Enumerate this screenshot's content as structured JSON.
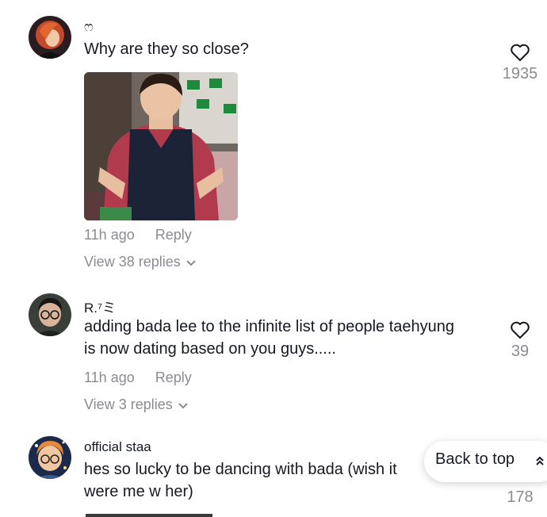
{
  "comments": [
    {
      "username": "ෆ",
      "text": "Why are they so close?",
      "time": "11h ago",
      "reply_label": "Reply",
      "view_replies": "View 38 replies",
      "likes": "1935",
      "has_gif": true
    },
    {
      "username": "R.⁷ミ",
      "text": "adding bada lee to the infinite list of people taehyung is now dating based on you guys.....",
      "time": "11h ago",
      "reply_label": "Reply",
      "view_replies": "View 3 replies",
      "likes": "39"
    },
    {
      "username": "official staa",
      "text": "hes so lucky to be dancing with bada (wish it were me w her)",
      "likes": "178"
    }
  ],
  "back_to_top": {
    "label": "Back to top"
  },
  "colors": {
    "text": "#161823",
    "secondary": "#8a8b91",
    "background": "#ffffff"
  },
  "icons": [
    "heart-outline-icon",
    "chevron-down-icon",
    "double-chevron-up-icon"
  ]
}
